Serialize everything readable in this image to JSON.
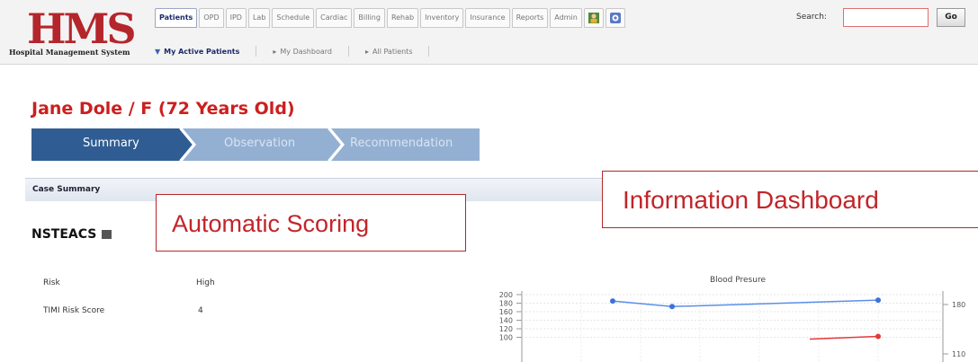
{
  "app": {
    "logo_text": "HMS",
    "logo_caption": "Hospital Management System"
  },
  "top_tabs": [
    "Patients",
    "OPD",
    "IPD",
    "Lab",
    "Schedule",
    "Cardiac",
    "Billing",
    "Rehab",
    "Inventory",
    "Insurance",
    "Reports",
    "Admin"
  ],
  "icons": [
    "person-icon",
    "help-icon"
  ],
  "search": {
    "label": "Search:",
    "value": "",
    "button": "Go"
  },
  "subnav": [
    "My Active Patients",
    "My Dashboard",
    "All Patients"
  ],
  "patient": {
    "title": "Jane Dole / F (72 Years Old)"
  },
  "steps": [
    "Summary",
    "Observation",
    "Recommendation"
  ],
  "case_summary": {
    "bar_label": "Case Summary",
    "score_name": "NSTEACS",
    "fields": [
      {
        "label": "Risk",
        "value": "High"
      },
      {
        "label": "TIMI Risk Score",
        "value": "4"
      }
    ]
  },
  "callouts": {
    "scoring": "Automatic Scoring",
    "dashboard": "Information Dashboard"
  },
  "colors": {
    "brand_red": "#cc1f1f",
    "step_active": "#2f5d93",
    "step_inactive": "#93b0d3",
    "series_blue": "#5b8fe8",
    "series_red": "#e23a3a"
  },
  "chart_data": {
    "type": "line",
    "title": "Blood Presure",
    "y_ticks": [
      "200",
      "180",
      "160",
      "140",
      "120",
      "100"
    ],
    "ylim": [
      100,
      200
    ],
    "right_ticks": [
      "180",
      "110"
    ],
    "series": [
      {
        "values": [
          185,
          172,
          187
        ]
      }
    ],
    "secondary_red_point": 102
  }
}
